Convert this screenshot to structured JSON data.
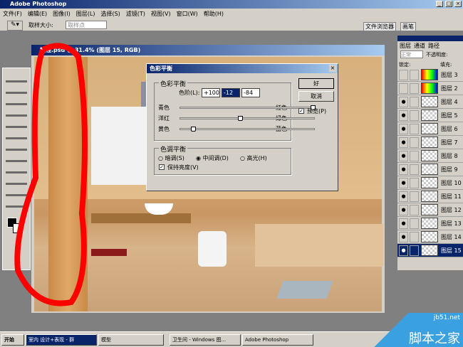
{
  "app": {
    "title": "Adobe Photoshop",
    "min": "_",
    "max": "□",
    "close": "×"
  },
  "menu": [
    "文件(F)",
    "编辑(E)",
    "图像(I)",
    "图层(L)",
    "选择(S)",
    "滤镜(T)",
    "视图(V)",
    "窗口(W)",
    "帮助(H)"
  ],
  "options": {
    "sample_size_label": "取样大小:",
    "sample_size_value": "取样点",
    "tabs": [
      "文件浏览器",
      "画笔"
    ]
  },
  "document": {
    "title": "教程.psd @ 31.4% (图层 15, RGB)"
  },
  "dialog": {
    "title": "色彩平衡",
    "close": "×",
    "group1": "色彩平衡",
    "levels_label": "色阶(L):",
    "levels": [
      "+100",
      "-12",
      "-84"
    ],
    "sliders": [
      {
        "left": "青色",
        "right": "红色",
        "value": 100
      },
      {
        "left": "洋红",
        "right": "绿色",
        "value": -12
      },
      {
        "left": "黄色",
        "right": "蓝色",
        "value": -84
      }
    ],
    "group2": "色调平衡",
    "tones": [
      {
        "label": "暗调(S)",
        "checked": false
      },
      {
        "label": "中间调(D)",
        "checked": true
      },
      {
        "label": "高光(H)",
        "checked": false
      }
    ],
    "preserve": "保持亮度(V)",
    "ok": "好",
    "cancel": "取消",
    "preview": "预览(P)"
  },
  "layers": {
    "tabs": [
      "图层",
      "通道",
      "路径"
    ],
    "blend": "正常",
    "opacity_label": "不透明度:",
    "lock_label": "锁定:",
    "fill_label": "填充:",
    "items": [
      "图层 3",
      "图层 2",
      "图层 4",
      "图层 5",
      "图层 6",
      "图层 7",
      "图层 8",
      "图层 9",
      "图层 10",
      "图层 11",
      "图层 12",
      "图层 13",
      "图层 14",
      "图层 15"
    ],
    "selected": "图层 15"
  },
  "taskbar": {
    "start": "开始",
    "tasks": [
      "室内 设计+表现 - 群",
      "模型",
      "卫生间 - Windows 图...",
      "Adobe Photoshop"
    ]
  },
  "watermark": {
    "site": "jb51.net",
    "name": "脚本之家"
  },
  "colors": {
    "title": "#0a246a",
    "annotation": "#ff0000"
  }
}
